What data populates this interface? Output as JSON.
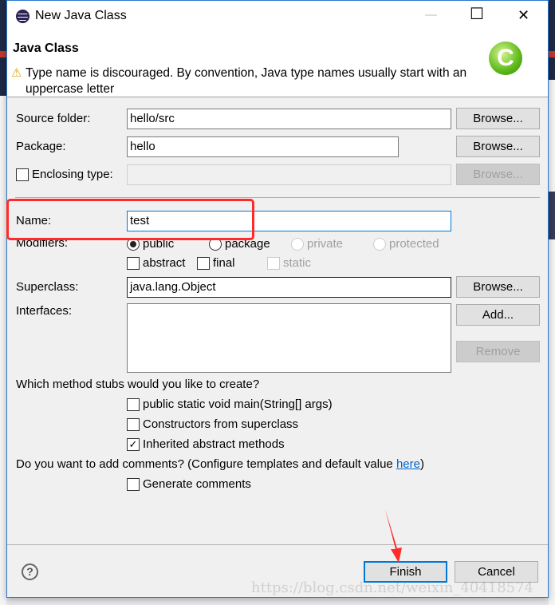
{
  "window": {
    "title": "New Java Class",
    "minimize": "—",
    "maximize": "☐",
    "close": "✕"
  },
  "header": {
    "title": "Java Class",
    "warning": "Type name is discouraged. By convention, Java type names usually start with an uppercase letter"
  },
  "form": {
    "source_folder": {
      "label": "Source folder:",
      "value": "hello/src",
      "button": "Browse..."
    },
    "package": {
      "label": "Package:",
      "value": "hello",
      "button": "Browse..."
    },
    "enclosing": {
      "label": "Enclosing type:",
      "value": "",
      "button": "Browse...",
      "checked": false
    },
    "name": {
      "label": "Name:",
      "value": "test"
    },
    "modifiers": {
      "label": "Modifiers:",
      "options": [
        "public",
        "package",
        "private",
        "protected"
      ],
      "selected": "public",
      "extra": [
        "abstract",
        "final",
        "static"
      ]
    },
    "superclass": {
      "label": "Superclass:",
      "value": "java.lang.Object",
      "button": "Browse..."
    },
    "interfaces": {
      "label": "Interfaces:",
      "add": "Add...",
      "remove": "Remove"
    },
    "stubs": {
      "question": "Which method stubs would you like to create?",
      "items": [
        {
          "label": "public static void main(String[] args)",
          "checked": false
        },
        {
          "label": "Constructors from superclass",
          "checked": false
        },
        {
          "label": "Inherited abstract methods",
          "checked": true
        }
      ]
    },
    "comments": {
      "question": "Do you want to add comments? (Configure templates and default value ",
      "link": "here",
      "close": ")",
      "generate": "Generate comments",
      "checked": false
    }
  },
  "footer": {
    "finish": "Finish",
    "cancel": "Cancel",
    "help": "?"
  },
  "watermark": "https://blog.csdn.net/weixin_40418574",
  "colors": {
    "accent": "#0078d7",
    "annotation": "#ff2a2a",
    "link": "#0066cc"
  }
}
